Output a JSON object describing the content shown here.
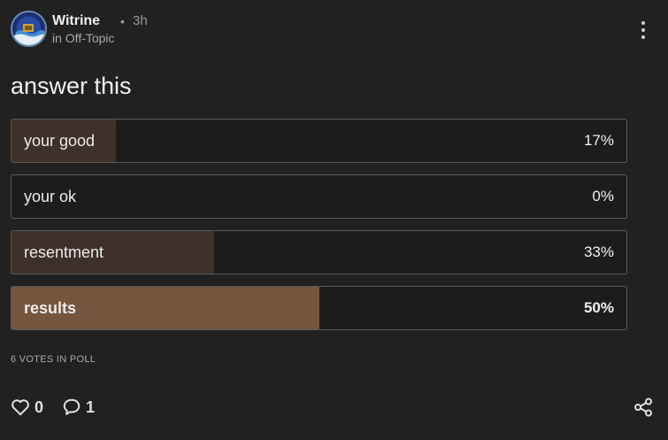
{
  "post": {
    "author": "Witrine",
    "separator": "•",
    "time": "3h",
    "channel": "in Off-Topic",
    "title": "answer this"
  },
  "poll": {
    "options": [
      {
        "label": "your good",
        "percent_text": "17%",
        "percent": 17,
        "fill_color": "#3d3129"
      },
      {
        "label": "your ok",
        "percent_text": "0%",
        "percent": 0,
        "fill_color": "#3d3129"
      },
      {
        "label": "resentment",
        "percent_text": "33%",
        "percent": 33,
        "fill_color": "#3d3129"
      },
      {
        "label": "results",
        "percent_text": "50%",
        "percent": 50,
        "fill_color": "#75553c",
        "leading": true
      }
    ],
    "votes_text": "6 VOTES IN POLL"
  },
  "actions": {
    "like_count": "0",
    "comment_count": "1",
    "like_icon": "heart-icon",
    "comment_icon": "speech-bubble-icon",
    "share_icon": "share-icon",
    "more_icon": "vertical-ellipsis-icon"
  }
}
